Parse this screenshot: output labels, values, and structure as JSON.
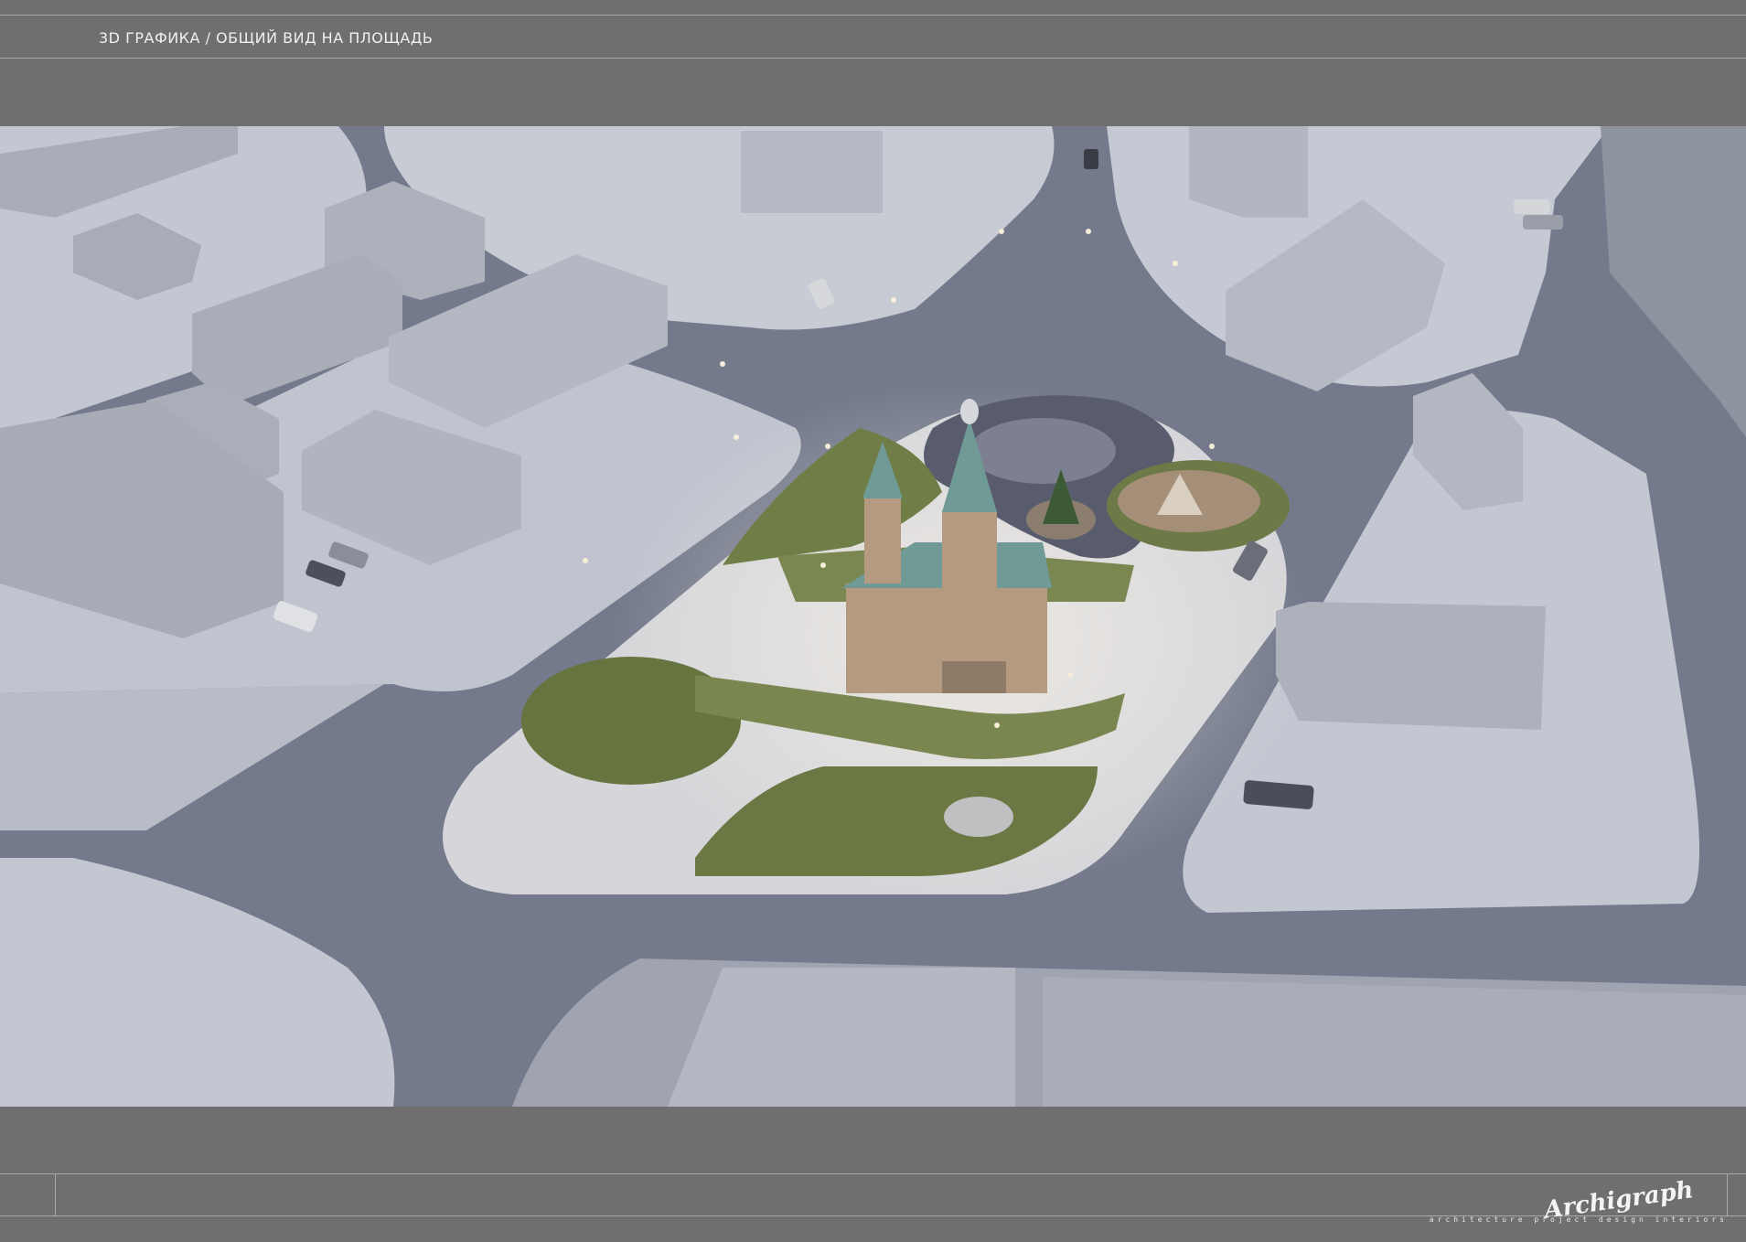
{
  "header": {
    "title": "3D ГРАФИКА / ОБЩИЙ ВИД НА ПЛОЩАДЬ"
  },
  "footer": {
    "logo_text": "Archigraph",
    "logo_tagline": "architecture project design interiors"
  },
  "colors": {
    "frame": "#6f6f6f",
    "rule": "#a9a9a9",
    "snow": "#c9cdd6",
    "road": "#7c8294",
    "building": "#aeb2bd",
    "plaza": "#cfcfd4",
    "greenery": "#6f7d4a",
    "church_roof": "#6f9a96"
  }
}
